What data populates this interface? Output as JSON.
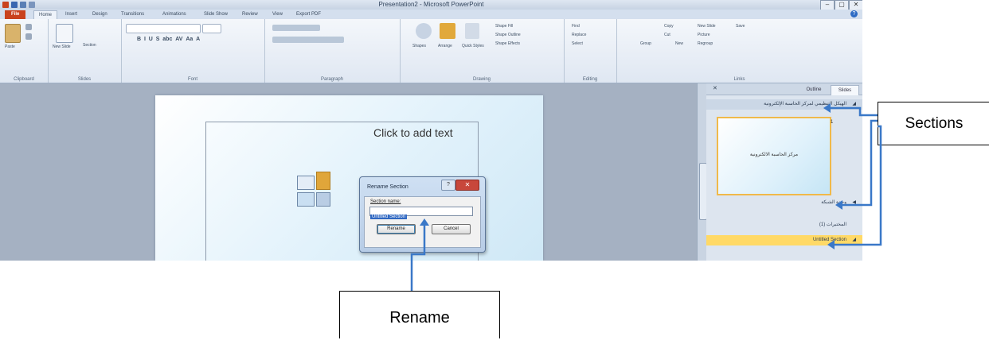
{
  "window": {
    "title": "Presentation2 - Microsoft PowerPoint",
    "controls": [
      "–",
      "▢",
      "✕"
    ]
  },
  "ribbon": {
    "tabs": [
      "File",
      "Home",
      "Insert",
      "Design",
      "Transitions",
      "Animations",
      "Slide Show",
      "Review",
      "View",
      "Export PDF"
    ],
    "groups": [
      "Clipboard",
      "Slides",
      "Font",
      "Paragraph",
      "Drawing",
      "Editing",
      "Links"
    ],
    "slides_group": {
      "new_slide": "New Slide",
      "section": "Section"
    },
    "clipboard_group": {
      "paste": "Paste"
    },
    "drawing_group": {
      "shapes": "Shapes",
      "arrange": "Arrange",
      "quick_styles": "Quick Styles",
      "shape_fill": "Shape Fill",
      "shape_outline": "Shape Outline",
      "shape_effects": "Shape Effects"
    },
    "editing_group": {
      "find": "Find",
      "replace": "Replace",
      "select": "Select"
    },
    "links_group": {
      "new_slide": "New Slide",
      "save": "Save",
      "picture": "Picture",
      "new": "New",
      "regroup": "Regroup",
      "group": "Group",
      "copy": "Copy",
      "cut": "Cut"
    }
  },
  "slide": {
    "placeholder_text": "Click to add text"
  },
  "dialog": {
    "title": "Rename Section",
    "help": "?",
    "close": "✕",
    "label": "Section name:",
    "value": "Untitled Section",
    "rename_button": "Rename",
    "cancel_button": "Cancel"
  },
  "pane": {
    "tabs": [
      "Outline",
      "Slides"
    ],
    "close": "✕",
    "sections": [
      "الهيكل التنظيمي لمركز الحاسبة الإلكترونية",
      "وحدة الشبكة",
      "المختبرات (1)",
      "Untitled Section"
    ],
    "thumbnail": {
      "number": "1",
      "text": "مركز الحاسبة الالكترونية"
    }
  },
  "callouts": {
    "sections": "Sections",
    "rename": "Rename"
  },
  "colors": {
    "file_tab": "#c9421d",
    "selected_section": "#ffd966",
    "arrow": "#3a78c8",
    "dialog_close": "#c8473b"
  }
}
